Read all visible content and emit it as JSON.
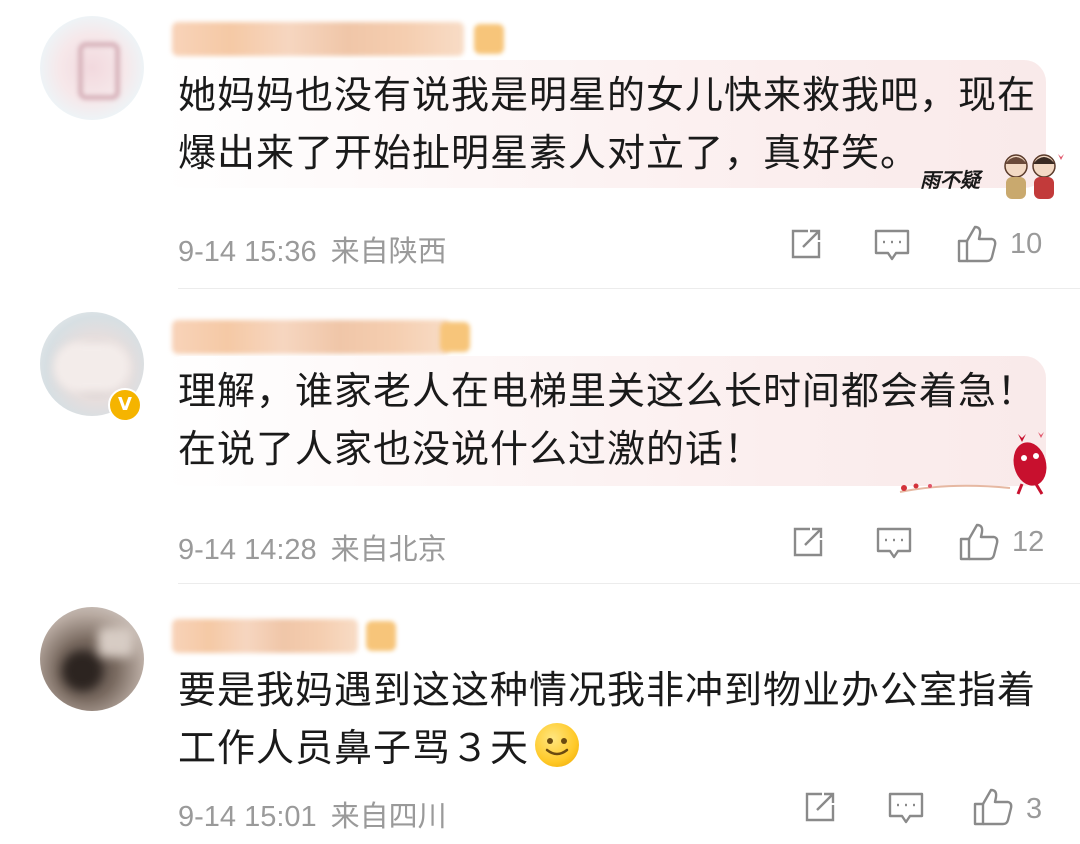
{
  "comments": [
    {
      "text_line1": "她妈妈也没有说我是明星的女儿快来救我吧，现在",
      "text_line2": "爆出来了开始扯明星素人对立了，真好笑。",
      "date": "9-14 15:36",
      "location": "来自陕西",
      "likes": "10",
      "bubble_deco_text": "雨不疑"
    },
    {
      "text_line1": "理解，谁家老人在电梯里关这么长时间都会着急！",
      "text_line2": "在说了人家也没说什么过激的话！",
      "date": "9-14 14:28",
      "location": "来自北京",
      "likes": "12",
      "verified": "V"
    },
    {
      "text_line1": "要是我妈遇到这这种情况我非冲到物业办公室指着",
      "text_line2": "工作人员鼻子骂３天",
      "date": "9-14 15:01",
      "location": "来自四川",
      "likes": "3"
    }
  ],
  "icons": {
    "share": "share-icon",
    "comment": "comment-icon",
    "like": "thumbs-up-icon",
    "emoji": "smile-emoji-icon"
  },
  "colors": {
    "meta_text": "#9a9a9a",
    "bubble_tint": "#f9eaea",
    "verified_badge": "#f5b400"
  }
}
